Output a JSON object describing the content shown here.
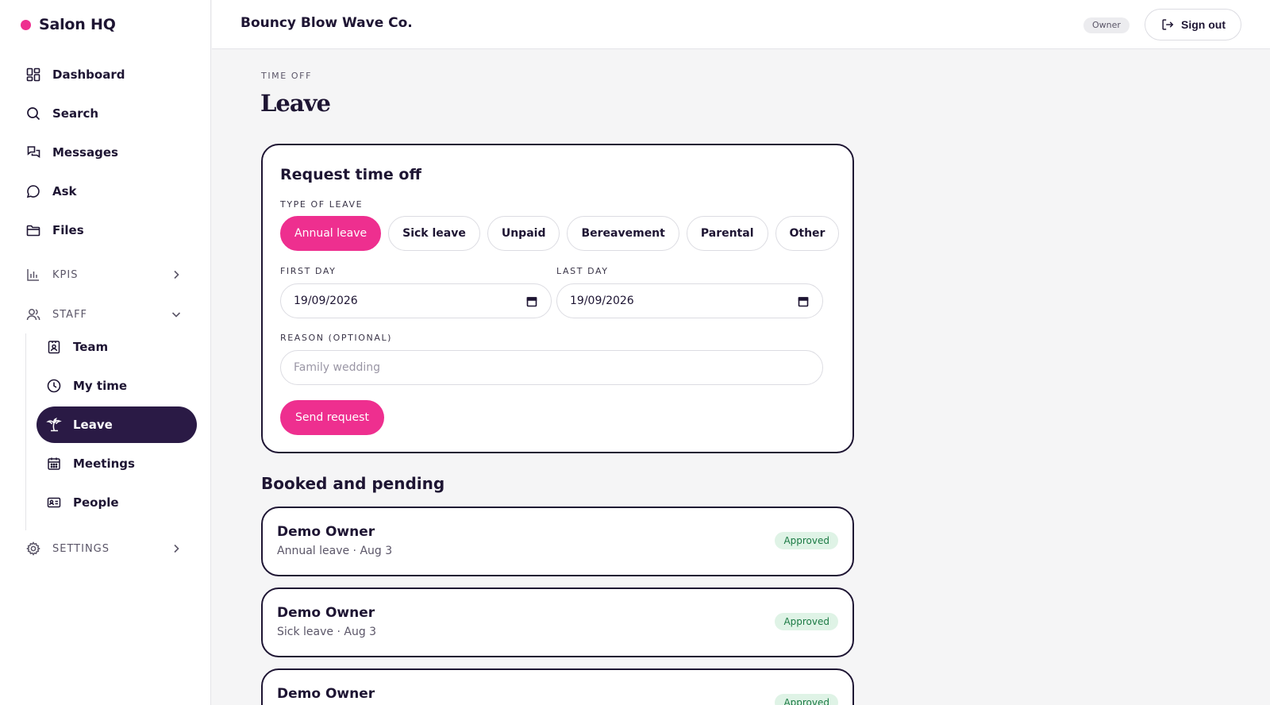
{
  "brand": {
    "name": "Salon HQ",
    "dot_color": "#ee2f8f"
  },
  "nav": {
    "items": [
      {
        "label": "Dashboard",
        "icon": "dashboard-icon"
      },
      {
        "label": "Search",
        "icon": "search-icon"
      },
      {
        "label": "Messages",
        "icon": "messages-icon"
      },
      {
        "label": "Ask",
        "icon": "chat-bubble-icon"
      },
      {
        "label": "Files",
        "icon": "folder-icon"
      }
    ],
    "sections": {
      "kpis": {
        "label": "KPIS",
        "icon": "bar-chart-icon",
        "expanded": false
      },
      "staff": {
        "label": "STAFF",
        "icon": "users-icon",
        "expanded": true
      },
      "settings": {
        "label": "SETTINGS",
        "icon": "gear-icon",
        "expanded": false
      }
    },
    "staff_items": [
      {
        "label": "Team",
        "icon": "id-badge-icon"
      },
      {
        "label": "My time",
        "icon": "clock-icon"
      },
      {
        "label": "Leave",
        "icon": "palm-tree-icon",
        "active": true
      },
      {
        "label": "Meetings",
        "icon": "calendar-icon"
      },
      {
        "label": "People",
        "icon": "id-card-icon"
      }
    ]
  },
  "topbar": {
    "org_name": "Bouncy Blow Wave Co.",
    "role": "Owner",
    "sign_out_label": "Sign out"
  },
  "page": {
    "eyebrow": "TIME OFF",
    "title": "Leave"
  },
  "request_form": {
    "title": "Request time off",
    "type_label": "TYPE OF LEAVE",
    "types": [
      "Annual leave",
      "Sick leave",
      "Unpaid",
      "Bereavement",
      "Parental",
      "Other"
    ],
    "selected_type": "Annual leave",
    "first_day_label": "FIRST DAY",
    "first_day_value": "19/09/2026",
    "last_day_label": "LAST DAY",
    "last_day_value": "19/09/2026",
    "reason_label": "REASON (OPTIONAL)",
    "reason_value": "",
    "reason_placeholder": "Family wedding",
    "submit_label": "Send request"
  },
  "booked": {
    "title": "Booked and pending",
    "entries": [
      {
        "name": "Demo Owner",
        "meta": "Annual leave · Aug 3",
        "status": "Approved"
      },
      {
        "name": "Demo Owner",
        "meta": "Sick leave · Aug 3",
        "status": "Approved"
      },
      {
        "name": "Demo Owner",
        "meta": "",
        "status": "Approved"
      }
    ]
  },
  "colors": {
    "accent": "#ee2f8f",
    "nav_active_bg": "#2a1a45",
    "text": "#1e1533",
    "approved_bg": "#dff3e6",
    "approved_text": "#1b7a44"
  }
}
